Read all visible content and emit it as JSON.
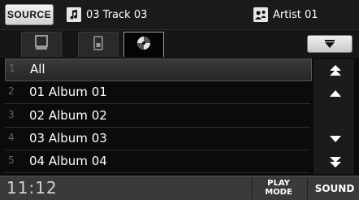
{
  "top": {
    "source_label": "SOURCE",
    "track": "03 Track 03",
    "artist": "Artist 01"
  },
  "tabs": [
    {
      "id": "folder",
      "active": false
    },
    {
      "id": "device",
      "active": false
    },
    {
      "id": "disc",
      "active": true
    }
  ],
  "list": {
    "rows": [
      {
        "num": "1",
        "label": "All",
        "selected": true
      },
      {
        "num": "2",
        "label": "01 Album 01",
        "selected": false
      },
      {
        "num": "3",
        "label": "02 Album 02",
        "selected": false
      },
      {
        "num": "4",
        "label": "03 Album 03",
        "selected": false
      },
      {
        "num": "5",
        "label": "04 Album 04",
        "selected": false
      }
    ]
  },
  "bottom": {
    "time": "11:12",
    "play_mode_line1": "PLAY",
    "play_mode_line2": "MODE",
    "sound_label": "SOUND"
  },
  "colors": {
    "background": "#0b0b0b",
    "selected_row": "#333333",
    "bottom_bar": "#3a3a3a"
  }
}
